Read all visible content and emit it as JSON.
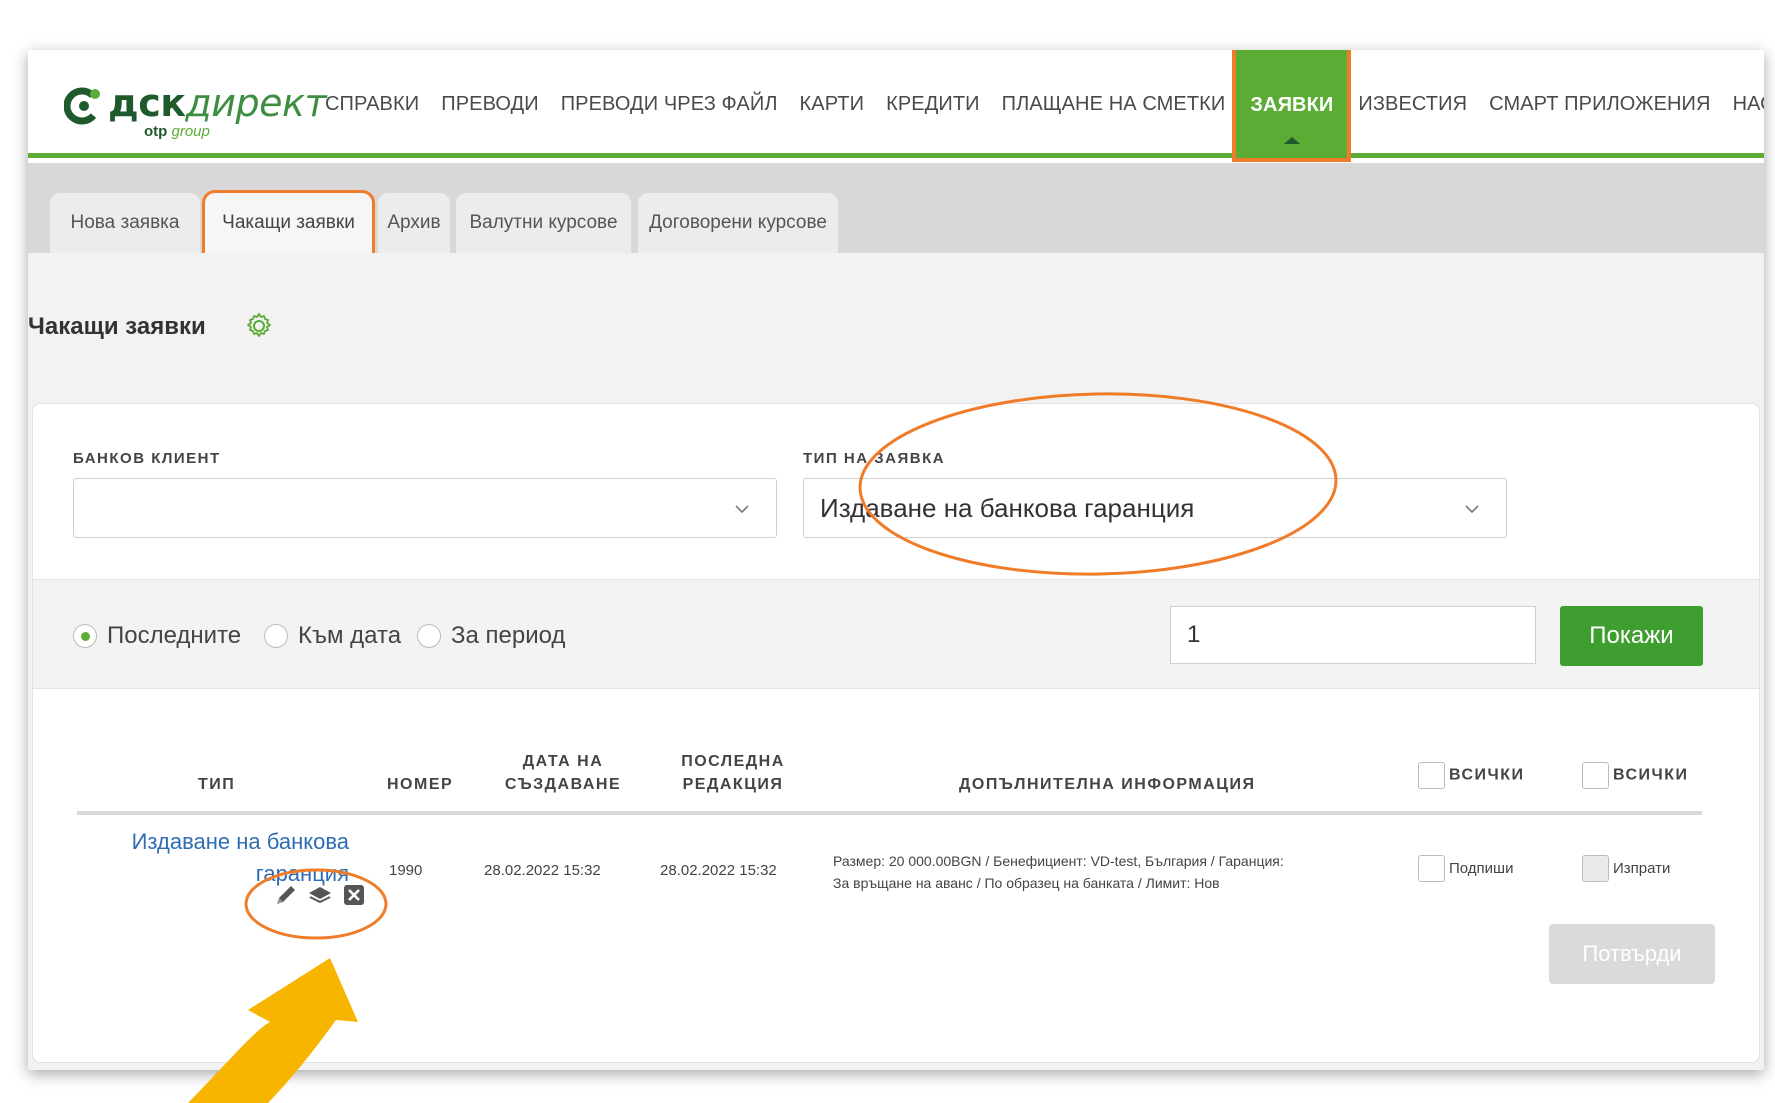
{
  "logo": {
    "brand_main": "дск",
    "brand_italic": "директ",
    "brand_sub_bold": "otp",
    "brand_sub": " group"
  },
  "nav": {
    "items": [
      {
        "label": "СПРАВКИ"
      },
      {
        "label": "ПРЕВОДИ"
      },
      {
        "label": "ПРЕВОДИ ЧРЕЗ ФАЙЛ"
      },
      {
        "label": "КАРТИ"
      },
      {
        "label": "КРЕДИТИ"
      },
      {
        "label": "ПЛАЩАНЕ НА СМЕТКИ"
      },
      {
        "label": "ЗАЯВКИ"
      },
      {
        "label": "ИЗВЕСТИЯ"
      },
      {
        "label": "СМАРТ ПРИЛОЖЕНИЯ"
      },
      {
        "label": "НАСТРОЙКИ"
      }
    ],
    "active": "ЗАЯВКИ"
  },
  "tabs": [
    {
      "label": "Нова заявка"
    },
    {
      "label": "Чакащи заявки"
    },
    {
      "label": "Архив"
    },
    {
      "label": "Валутни курсове"
    },
    {
      "label": "Договорени курсове"
    }
  ],
  "page": {
    "title": "Чакащи заявки",
    "settings_icon": "gear-icon"
  },
  "filters": {
    "client_label": "БАНКОВ КЛИЕНТ",
    "client_value": "",
    "type_label": "ТИП НА ЗАЯВКА",
    "type_value": "Издаване на банкова гаранция",
    "radios": [
      {
        "label": "Последните",
        "selected": true
      },
      {
        "label": "Към дата",
        "selected": false
      },
      {
        "label": "За период",
        "selected": false
      }
    ],
    "count_value": "1",
    "show_button": "Покажи"
  },
  "table": {
    "headers": {
      "type": "ТИП",
      "number": "НОМЕР",
      "created_1": "ДАТА НА",
      "created_2": "СЪЗДАВАНЕ",
      "edited_1": "ПОСЛЕДНА",
      "edited_2": "РЕДАКЦИЯ",
      "info": "ДОПЪЛНИТЕЛНА ИНФОРМАЦИЯ",
      "all_sign": "всички",
      "all_send": "всички"
    },
    "rows": [
      {
        "type_line1": "Издаване на банкова",
        "type_line2": "гаранция",
        "number": "1990",
        "created": "28.02.2022 15:32",
        "edited": "28.02.2022 15:32",
        "info_line1": "Размер: 20 000.00BGN / Бенефициент: VD-test, България / Гаранция:",
        "info_line2": "За връщане на аванс / По образец на банката / Лимит: Нов",
        "sign_label": "Подпиши",
        "send_label": "Изпрати",
        "action_icons": [
          "pencil-icon",
          "layers-icon",
          "delete-box-icon"
        ]
      }
    ],
    "confirm_button": "Потвърди"
  },
  "colors": {
    "brand_green": "#5aac34",
    "dark_green": "#1e5a2c",
    "highlight_orange": "#f07c2a",
    "arrow_yellow": "#f7b500",
    "link_blue": "#2f6db3"
  }
}
